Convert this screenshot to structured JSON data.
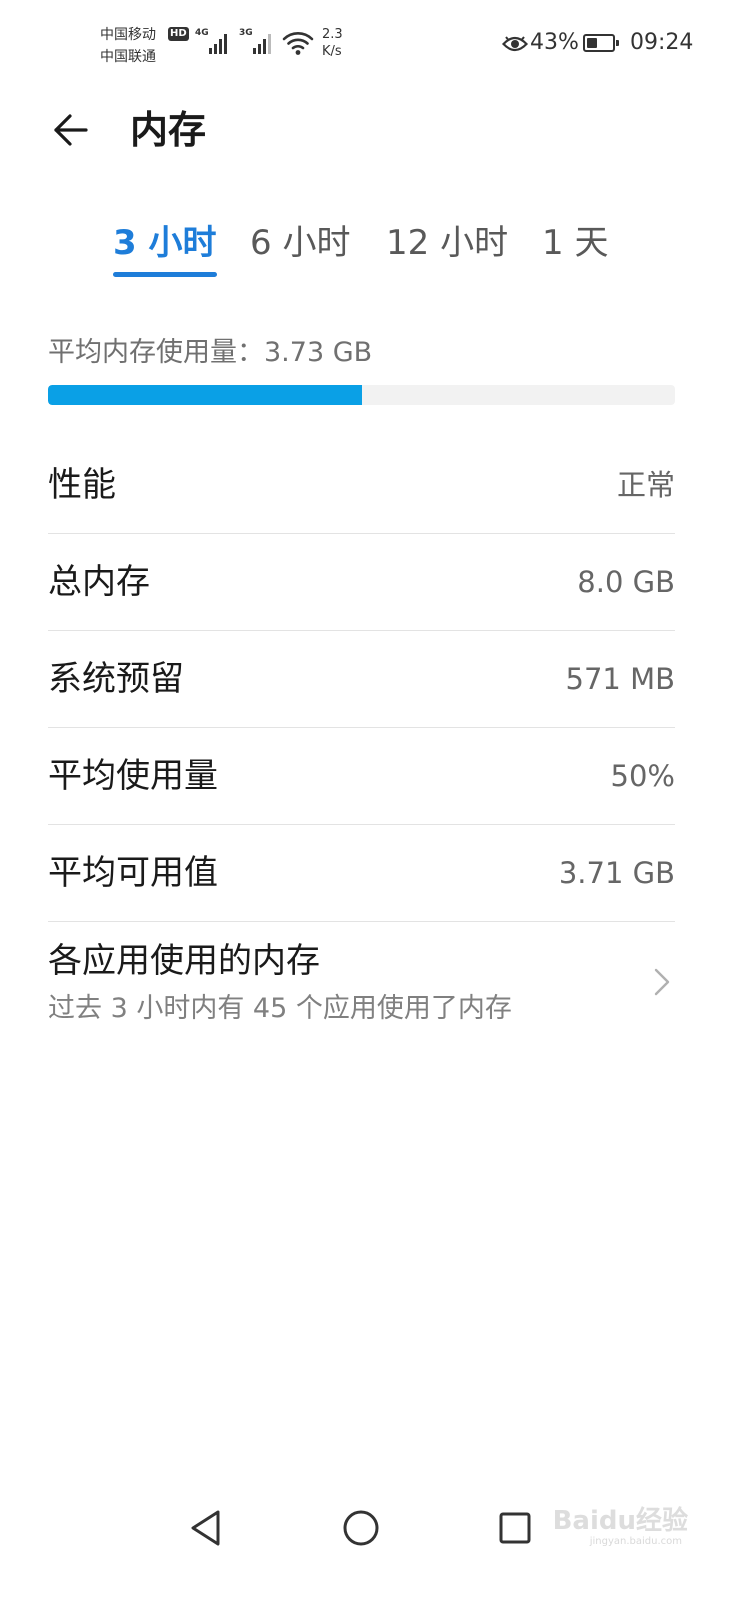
{
  "status_bar": {
    "carrier_1": "中国移动",
    "carrier_2": "中国联通",
    "hd_badge": "HD",
    "signal_1_tag": "4G",
    "signal_2_tag": "3G",
    "net_speed_value": "2.3",
    "net_speed_unit": "K/s",
    "battery_percent": "43%",
    "battery_level": 0.43,
    "time": "09:24",
    "icons": [
      "signal-4g-icon",
      "signal-3g-icon",
      "wifi-icon",
      "eye-icon",
      "battery-icon"
    ]
  },
  "header": {
    "back_icon": "arrow-left-icon",
    "title": "内存"
  },
  "tabs": {
    "items": [
      {
        "label": "3 小时",
        "active": true
      },
      {
        "label": "6 小时",
        "active": false
      },
      {
        "label": "12 小时",
        "active": false
      },
      {
        "label": "1 天",
        "active": false
      }
    ],
    "accent_color": "#1e7dd9"
  },
  "usage": {
    "summary": "平均内存使用量：3.73 GB",
    "bar_fraction": 0.5,
    "bar_color": "#0aa0e6"
  },
  "info_rows": [
    {
      "label": "性能",
      "value": "正常"
    },
    {
      "label": "总内存",
      "value": "8.0 GB"
    },
    {
      "label": "系统预留",
      "value": "571 MB"
    },
    {
      "label": "平均使用量",
      "value": "50%"
    },
    {
      "label": "平均可用值",
      "value": "3.71 GB"
    }
  ],
  "app_memory": {
    "title": "各应用使用的内存",
    "subtitle": "过去 3 小时内有 45 个应用使用了内存",
    "icon": "chevron-right-icon"
  },
  "nav_bar": {
    "icons": [
      "back-triangle-icon",
      "home-circle-icon",
      "recents-square-icon"
    ]
  },
  "watermark": {
    "text": "Baidu经验",
    "url_text": "jingyan.baidu.com"
  }
}
